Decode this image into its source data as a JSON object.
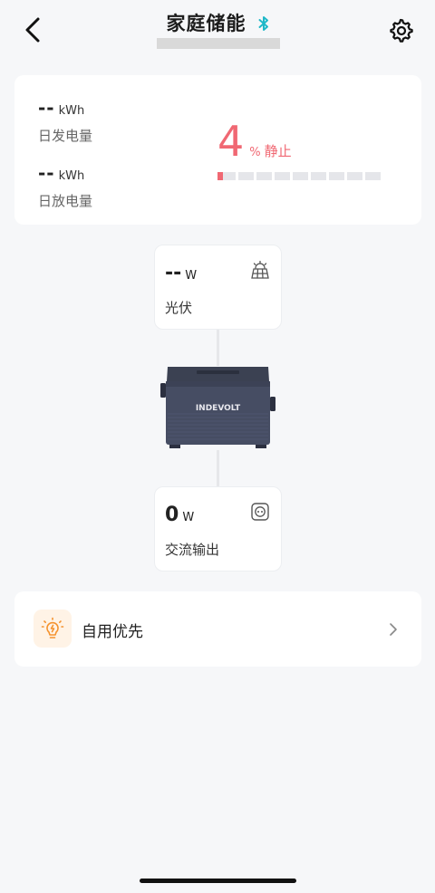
{
  "header": {
    "title": "家庭储能",
    "bluetooth_icon": "bluetooth-icon",
    "bluetooth_color": "#1fb8c8",
    "back_icon": "back-arrow-icon",
    "settings_icon": "gear-icon"
  },
  "energy": {
    "daily_generation": {
      "value": "--",
      "unit": "kWh",
      "label": "日发电量"
    },
    "daily_discharge": {
      "value": "--",
      "unit": "kWh",
      "label": "日放电量"
    },
    "battery": {
      "value": "4",
      "unit": "%",
      "state": "静止",
      "level_percent": 4,
      "accent": "#f06873"
    }
  },
  "flow": {
    "pv": {
      "value": "--",
      "unit": "W",
      "label": "光伏",
      "icon": "solar-panel-icon"
    },
    "device": {
      "brand": "INDEVOLT"
    },
    "ac": {
      "value": "0",
      "unit": "W",
      "label": "交流输出",
      "icon": "outlet-icon"
    }
  },
  "mode": {
    "label": "自用优先",
    "icon": "lightbulb-icon",
    "icon_color": "#f5922d"
  }
}
